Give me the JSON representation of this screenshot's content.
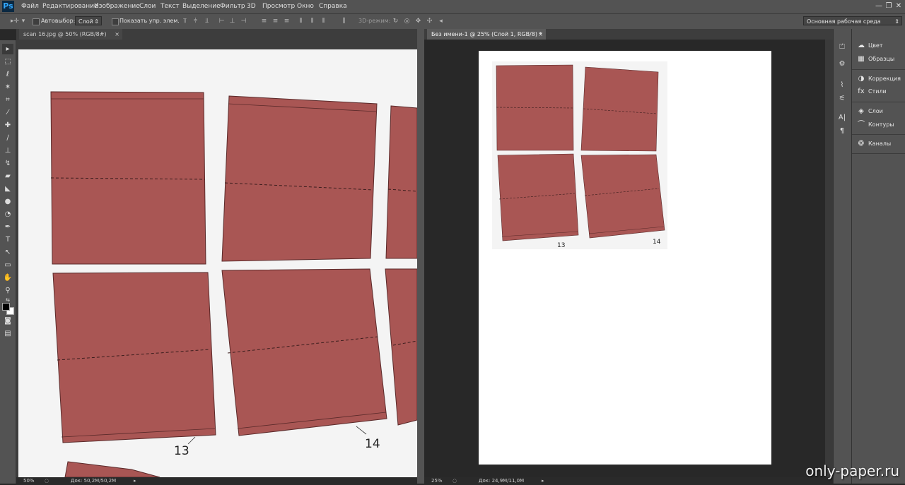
{
  "app": {
    "logo": "Ps"
  },
  "menu": [
    "Файл",
    "Редактирование",
    "Изображение",
    "Слои",
    "Текст",
    "Выделение",
    "Фильтр",
    "3D",
    "Просмотр",
    "Окно",
    "Справка"
  ],
  "window_controls": {
    "minimize": "—",
    "maximize": "❐",
    "close": "✕"
  },
  "options": {
    "autoselect_label": "Автовыбор:",
    "autoselect_value": "Слой",
    "show_controls_label": "Показать упр. элем.",
    "mode3d_label": "3D-режим:",
    "workspace": "Основная рабочая среда"
  },
  "docs": {
    "left": {
      "tab": "scan 16.jpg @ 50% (RGB/8#)",
      "close": "×",
      "zoom": "50%",
      "info": "Док: 50,2M/50,2M",
      "labels": [
        "13",
        "14"
      ]
    },
    "right": {
      "tab": "Без имени-1 @ 25% (Слой 1, RGB/8) *",
      "close": "×",
      "zoom": "25%",
      "info": "Док: 24,9M/11,0M",
      "labels": [
        "13",
        "14"
      ]
    }
  },
  "panels": {
    "group1": [
      "Цвет",
      "Образцы"
    ],
    "group2": [
      "Коррекция",
      "Стили"
    ],
    "group3": [
      "Слои",
      "Контуры"
    ],
    "group4": [
      "Каналы"
    ]
  },
  "watermark": "only-paper.ru",
  "colors": {
    "paper": "#a95654",
    "ui": "#535353",
    "canvas_bg": "#282828"
  }
}
